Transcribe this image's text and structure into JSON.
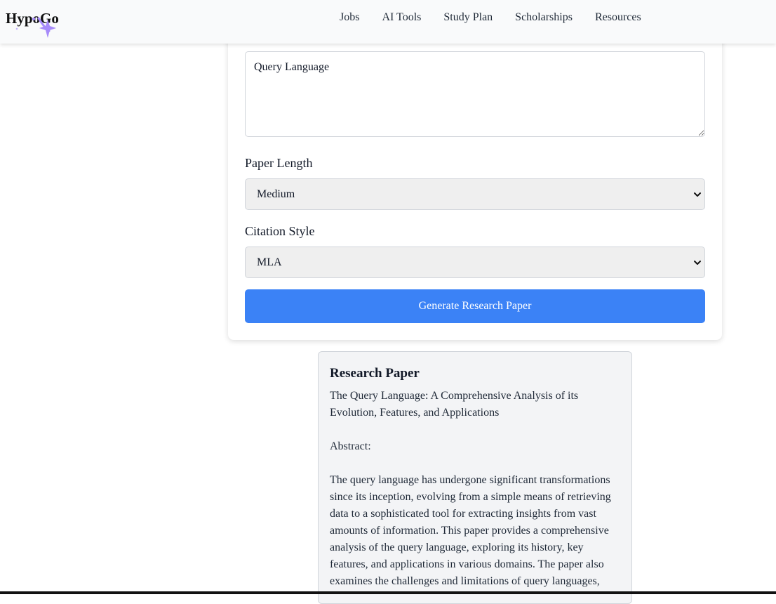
{
  "header": {
    "logo": "HypoGo",
    "nav": [
      "Jobs",
      "AI Tools",
      "Study Plan",
      "Scholarships",
      "Resources"
    ]
  },
  "form": {
    "topic_value": "Query Language",
    "length_label": "Paper Length",
    "length_value": "Medium",
    "citation_label": "Citation Style",
    "citation_value": "MLA",
    "generate_label": "Generate Research Paper"
  },
  "result": {
    "heading": "Research Paper",
    "paper_title": "The Query Language: A Comprehensive Analysis of its Evolution, Features, and Applications",
    "abstract_heading": "Abstract:",
    "abstract_body": "The query language has undergone significant transformations since its inception, evolving from a simple means of retrieving data to a sophisticated tool for extracting insights from vast amounts of information. This paper provides a comprehensive analysis of the query language, exploring its history, key features, and applications in various domains. The paper also examines the challenges and limitations of query languages,"
  },
  "colors": {
    "accent": "#3b82f6",
    "logo_star": "#a78bfa"
  }
}
